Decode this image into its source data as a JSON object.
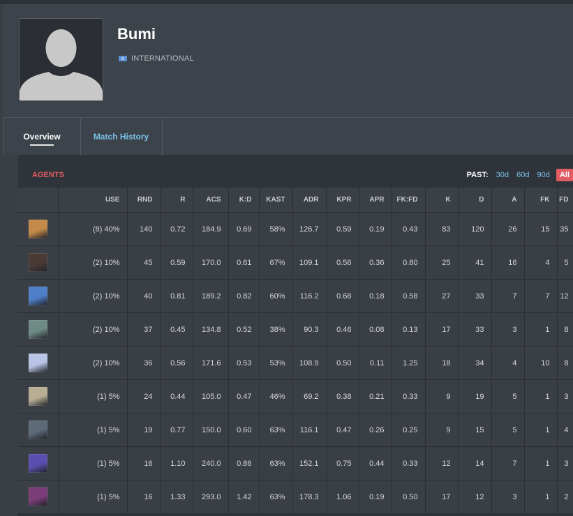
{
  "player": {
    "name": "Bumi",
    "country": "INTERNATIONAL"
  },
  "tabs": [
    {
      "label": "Overview",
      "active": true
    },
    {
      "label": "Match History",
      "active": false
    }
  ],
  "agents_section": {
    "title": "AGENTS",
    "past_label": "PAST:",
    "periods": [
      "30d",
      "60d",
      "90d"
    ],
    "active_period": "All"
  },
  "table": {
    "columns": [
      "USE",
      "RND",
      "R",
      "ACS",
      "K:D",
      "KAST",
      "ADR",
      "KPR",
      "APR",
      "FK:FD",
      "K",
      "D",
      "A",
      "FK",
      "FD"
    ],
    "rows": [
      {
        "icon": "agent-portrait-1",
        "color": "#c48a4a",
        "cells": [
          "(8) 40%",
          "140",
          "0.72",
          "184.9",
          "0.69",
          "58%",
          "126.7",
          "0.59",
          "0.19",
          "0.43",
          "83",
          "120",
          "26",
          "15",
          "35"
        ]
      },
      {
        "icon": "agent-portrait-2",
        "color": "#4a3a36",
        "cells": [
          "(2) 10%",
          "45",
          "0.59",
          "170.0",
          "0.61",
          "67%",
          "109.1",
          "0.56",
          "0.36",
          "0.80",
          "25",
          "41",
          "16",
          "4",
          "5"
        ]
      },
      {
        "icon": "agent-portrait-3",
        "color": "#4f7fc9",
        "cells": [
          "(2) 10%",
          "40",
          "0.81",
          "189.2",
          "0.82",
          "60%",
          "116.2",
          "0.68",
          "0.18",
          "0.58",
          "27",
          "33",
          "7",
          "7",
          "12"
        ]
      },
      {
        "icon": "agent-portrait-4",
        "color": "#6e8a84",
        "cells": [
          "(2) 10%",
          "37",
          "0.45",
          "134.8",
          "0.52",
          "38%",
          "90.3",
          "0.46",
          "0.08",
          "0.13",
          "17",
          "33",
          "3",
          "1",
          "8"
        ]
      },
      {
        "icon": "agent-portrait-5",
        "color": "#b9c4e6",
        "cells": [
          "(2) 10%",
          "36",
          "0.56",
          "171.6",
          "0.53",
          "53%",
          "108.9",
          "0.50",
          "0.11",
          "1.25",
          "18",
          "34",
          "4",
          "10",
          "8"
        ]
      },
      {
        "icon": "agent-portrait-6",
        "color": "#b7ae94",
        "cells": [
          "(1) 5%",
          "24",
          "0.44",
          "105.0",
          "0.47",
          "46%",
          "69.2",
          "0.38",
          "0.21",
          "0.33",
          "9",
          "19",
          "5",
          "1",
          "3"
        ]
      },
      {
        "icon": "agent-portrait-7",
        "color": "#5d6a78",
        "cells": [
          "(1) 5%",
          "19",
          "0.77",
          "150.0",
          "0.60",
          "63%",
          "116.1",
          "0.47",
          "0.26",
          "0.25",
          "9",
          "15",
          "5",
          "1",
          "4"
        ]
      },
      {
        "icon": "agent-portrait-8",
        "color": "#5a4fb0",
        "cells": [
          "(1) 5%",
          "16",
          "1.10",
          "240.0",
          "0.86",
          "63%",
          "152.1",
          "0.75",
          "0.44",
          "0.33",
          "12",
          "14",
          "7",
          "1",
          "3"
        ]
      },
      {
        "icon": "agent-portrait-9",
        "color": "#7b3d78",
        "cells": [
          "(1) 5%",
          "16",
          "1.33",
          "293.0",
          "1.42",
          "63%",
          "178.3",
          "1.06",
          "0.19",
          "0.50",
          "17",
          "12",
          "3",
          "1",
          "2"
        ]
      }
    ]
  }
}
